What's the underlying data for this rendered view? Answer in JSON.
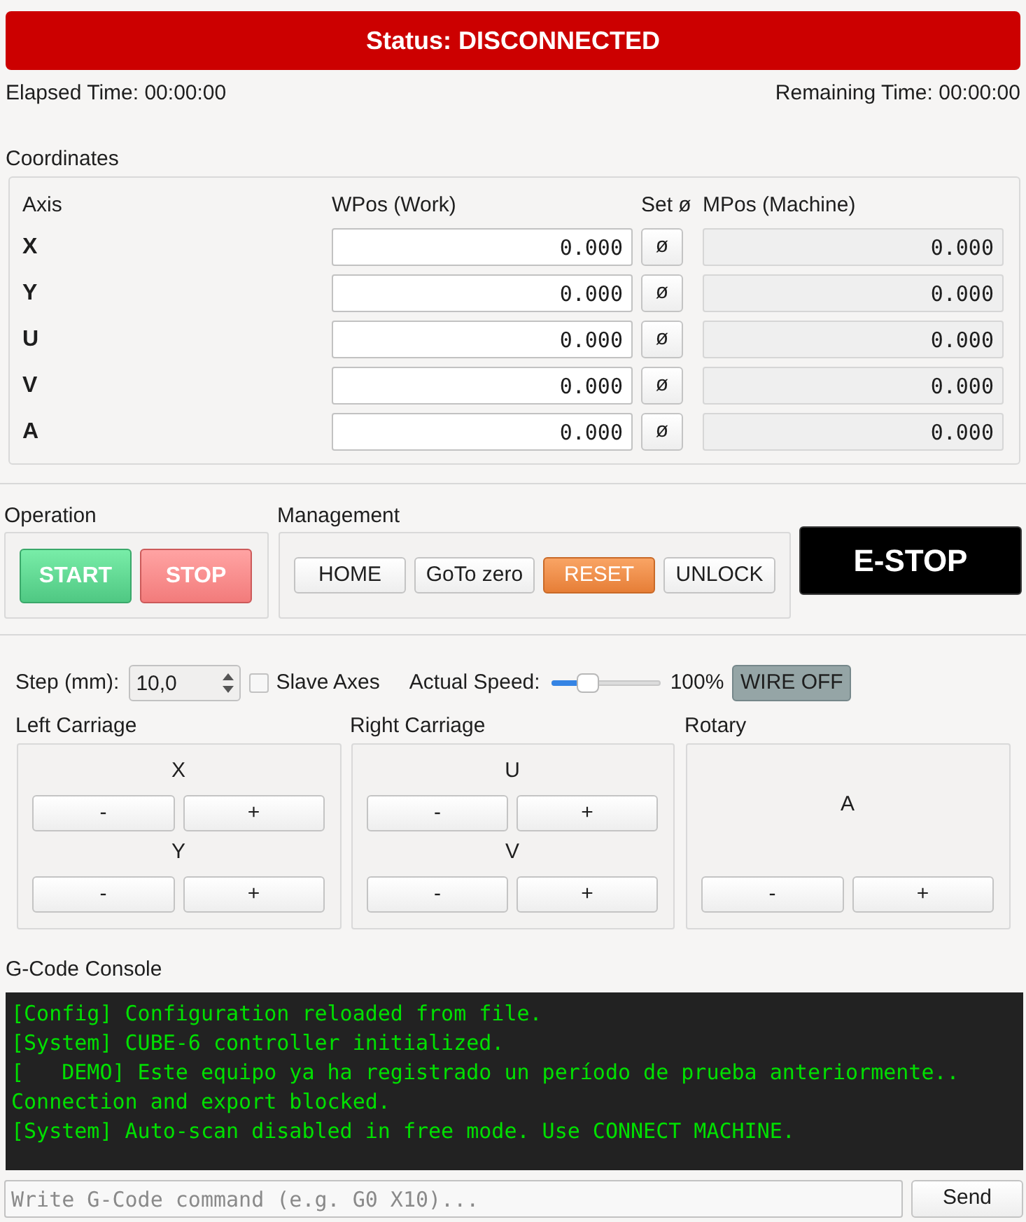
{
  "status_bar": {
    "label": "Status: DISCONNECTED",
    "connected": false
  },
  "timers": {
    "elapsed": "Elapsed Time: 00:00:00",
    "remaining": "Remaining Time: 00:00:00"
  },
  "coordinates": {
    "title": "Coordinates",
    "columns": [
      "Axis",
      "WPos (Work)",
      "Set ø",
      "MPos (Machine)"
    ],
    "rows": [
      {
        "axis": "X",
        "wpos": "0.000",
        "set_zero": "ø",
        "mpos": "0.000"
      },
      {
        "axis": "Y",
        "wpos": "0.000",
        "set_zero": "ø",
        "mpos": "0.000"
      },
      {
        "axis": "U",
        "wpos": "0.000",
        "set_zero": "ø",
        "mpos": "0.000"
      },
      {
        "axis": "V",
        "wpos": "0.000",
        "set_zero": "ø",
        "mpos": "0.000"
      },
      {
        "axis": "A",
        "wpos": "0.000",
        "set_zero": "ø",
        "mpos": "0.000"
      }
    ]
  },
  "operation": {
    "title": "Operation",
    "buttons": [
      {
        "label": "START",
        "kind": "start"
      },
      {
        "label": "STOP",
        "kind": "stop"
      }
    ]
  },
  "management": {
    "title": "Management",
    "buttons": [
      {
        "label": "HOME",
        "kind": "normal"
      },
      {
        "label": "GoTo zero",
        "kind": "normal"
      },
      {
        "label": "RESET",
        "kind": "warning"
      },
      {
        "label": "UNLOCK",
        "kind": "normal"
      }
    ]
  },
  "estop": {
    "label": "E-STOP"
  },
  "jog_settings": {
    "step_label": "Step (mm):",
    "step_value": "10,0",
    "slave_axes": {
      "label": "Slave Axes",
      "checked": false
    },
    "speed_label": "Actual Speed:",
    "speed": {
      "level": 0.33,
      "reading": "100%"
    },
    "wire_button": {
      "label": "WIRE OFF",
      "on": false
    }
  },
  "jog_groups": [
    {
      "title": "Left Carriage",
      "axes": [
        {
          "label": "X",
          "minus": "-",
          "plus": "+"
        },
        {
          "label": "Y",
          "minus": "-",
          "plus": "+"
        }
      ]
    },
    {
      "title": "Right Carriage",
      "axes": [
        {
          "label": "U",
          "minus": "-",
          "plus": "+"
        },
        {
          "label": "V",
          "minus": "-",
          "plus": "+"
        }
      ]
    },
    {
      "title": "Rotary",
      "axes": [
        {
          "label": "A",
          "minus": "-",
          "plus": "+"
        }
      ]
    }
  ],
  "console": {
    "title": "G-Code Console",
    "lines": [
      "[Config] Configuration reloaded from file.",
      "[System] CUBE-6 controller initialized.",
      "[   DEMO] Este equipo ya ha registrado un período de prueba anteriormente..",
      "Connection and export blocked.",
      "[System] Auto-scan disabled in free mode. Use CONNECT MACHINE."
    ]
  },
  "command": {
    "placeholder": "Write G-Code command (e.g. G0 X10)...",
    "send": "Send"
  }
}
